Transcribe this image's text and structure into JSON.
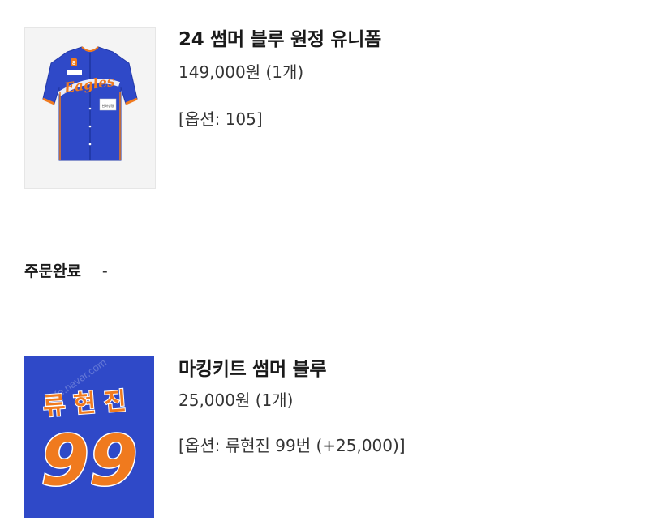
{
  "items": [
    {
      "title": "24 썸머 블루 원정 유니폼",
      "price": "149,000원 (1개)",
      "option": "[옵션: 105]",
      "image": {
        "jersey_text": "Eagles",
        "chest_patch": "한화생명",
        "number_patch": "8"
      }
    },
    {
      "title": "마킹키트 썸머 블루",
      "price": "25,000원 (1개)",
      "option": "[옵션: 류현진 99번 (+25,000)]",
      "image": {
        "name_text": "류현진",
        "number_text": "99",
        "watermark": "cafe.naver.com"
      }
    }
  ],
  "order_status": {
    "label": "주문완료",
    "value": "-"
  },
  "colors": {
    "jersey_blue": "#2f49c8",
    "accent_orange": "#f07a1e"
  }
}
